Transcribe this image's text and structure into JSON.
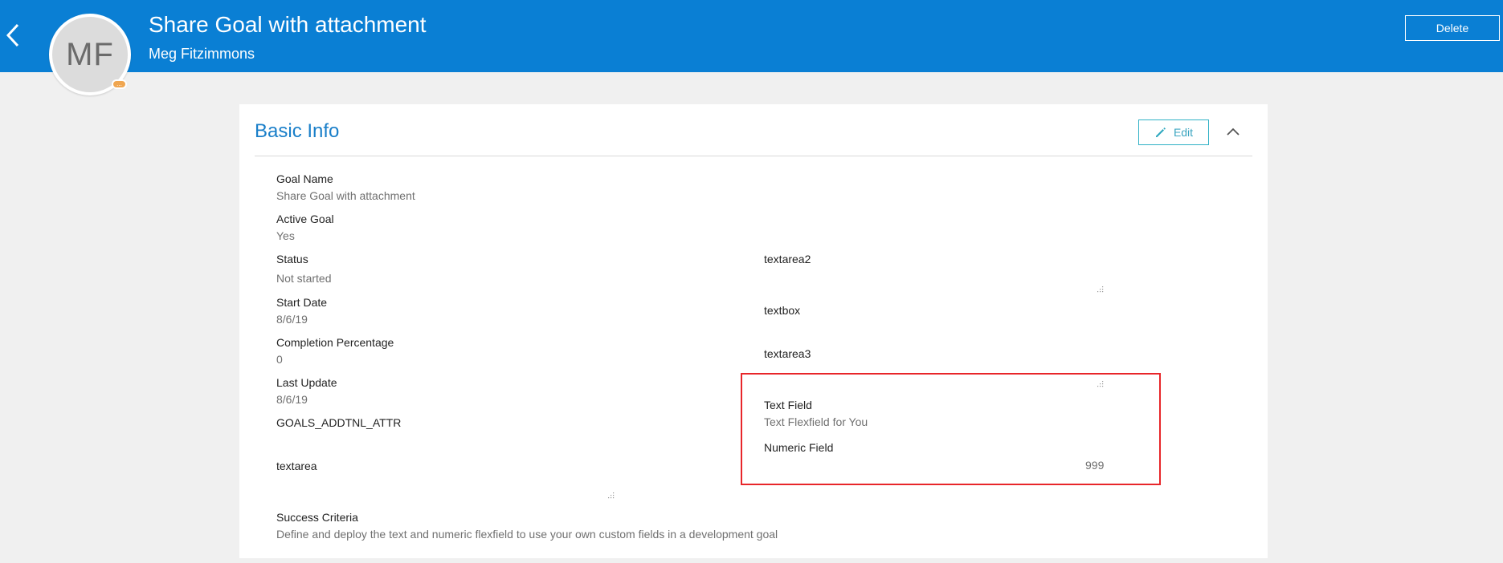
{
  "header": {
    "title": "Share Goal with attachment",
    "subtitle": "Meg Fitzimmons",
    "avatar_initials": "MF",
    "presence_badge": "...",
    "delete_label": "Delete",
    "bar_color": "#0a7fd4"
  },
  "basic_info": {
    "title": "Basic Info",
    "edit_label": "Edit",
    "left_fields": [
      {
        "label": "Goal Name",
        "value": "Share Goal with attachment"
      },
      {
        "label": "Active Goal",
        "value": "Yes"
      },
      {
        "label": "Status",
        "value": "Not started"
      },
      {
        "label": "Start Date",
        "value": "8/6/19"
      },
      {
        "label": "Completion Percentage",
        "value": "0"
      },
      {
        "label": "Last Update",
        "value": "8/6/19"
      },
      {
        "label": "GOALS_ADDTNL_ATTR",
        "value": ""
      },
      {
        "label": "textarea",
        "value": ""
      },
      {
        "label": "Success Criteria",
        "value": "Define and deploy the text and numeric flexfield to use your own custom fields in a development goal"
      }
    ],
    "right_fields": [
      {
        "label": "textarea2",
        "value": ""
      },
      {
        "label": "textbox",
        "value": ""
      },
      {
        "label": "textarea3",
        "value": ""
      },
      {
        "label": "Text Field",
        "value": "Text Flexfield for You"
      },
      {
        "label": "Numeric Field",
        "value": "999"
      }
    ]
  },
  "icons": {
    "back": "chevron-left-icon",
    "edit": "pencil-icon",
    "collapse": "chevron-up-icon",
    "resize": "resize-grip-icon"
  },
  "colors": {
    "accent": "#1a7fc9",
    "edit_border": "#2fb1c6",
    "highlight": "#e8262a"
  }
}
